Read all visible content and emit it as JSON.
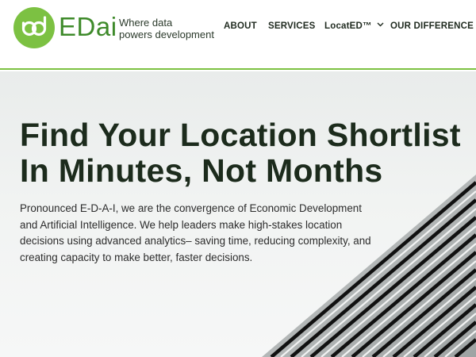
{
  "brand": {
    "name": "EDai",
    "tagline_line1": "Where data",
    "tagline_line2": "powers development",
    "accent_color": "#7cc142",
    "logo_word_color": "#3e8a2a"
  },
  "nav": {
    "items": [
      {
        "label": "ABOUT"
      },
      {
        "label": "SERVICES"
      },
      {
        "label": "LocatED™"
      },
      {
        "label": "OUR DIFFERENCE"
      }
    ]
  },
  "hero": {
    "title_line1": "Find Your Location Shortlist",
    "title_line2": "In Minutes, Not Months",
    "body": "Pronounced E-D-A-I, we are the convergence of Economic Development and Artificial Intelligence. We help leaders make high-stakes location decisions using advanced analytics– saving time, reducing complexity, and creating capacity to make better, faster decisions."
  },
  "icons": {
    "logo": "edai-logo-icon",
    "dropdown": "chevron-down-icon"
  }
}
